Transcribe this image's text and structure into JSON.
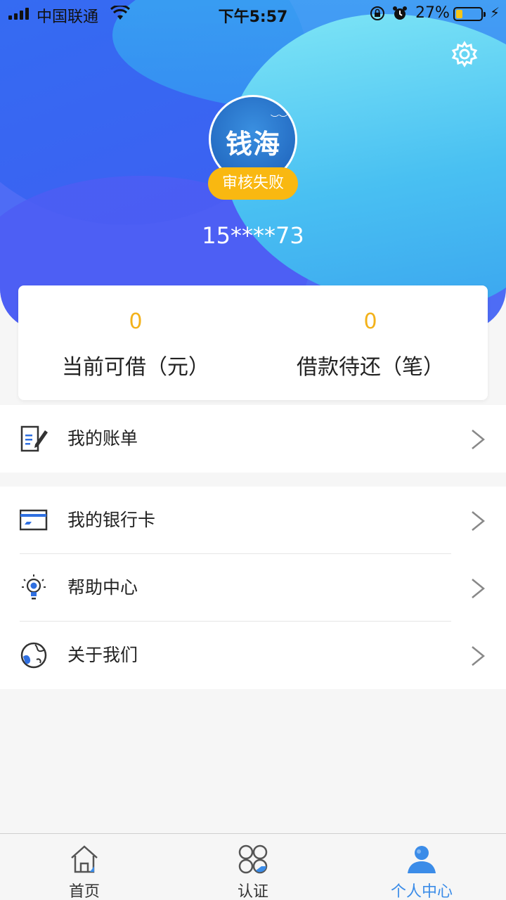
{
  "status_bar": {
    "carrier": "中国联通",
    "time": "下午5:57",
    "battery_percent": "27%",
    "battery_level": 0.27,
    "icons": [
      "signal-icon",
      "wifi-icon",
      "orientation-lock-icon",
      "alarm-icon",
      "battery-icon",
      "charging-icon"
    ]
  },
  "profile": {
    "avatar_text": "钱海",
    "status_badge": "审核失败",
    "phone": "15****73"
  },
  "stats": [
    {
      "value": "0",
      "label": "当前可借（元）"
    },
    {
      "value": "0",
      "label": "借款待还（笔）"
    }
  ],
  "menu_group1": [
    {
      "label": "我的账单",
      "icon": "bill-icon"
    }
  ],
  "menu_group2": [
    {
      "label": "我的银行卡",
      "icon": "bank-card-icon"
    },
    {
      "label": "帮助中心",
      "icon": "lightbulb-icon"
    },
    {
      "label": "关于我们",
      "icon": "globe-icon"
    }
  ],
  "tabbar": {
    "items": [
      {
        "label": "首页",
        "icon": "home-icon",
        "active": false
      },
      {
        "label": "认证",
        "icon": "certification-icon",
        "active": false
      },
      {
        "label": "个人中心",
        "icon": "user-icon",
        "active": true
      }
    ]
  },
  "colors": {
    "accent_blue": "#3b8ce8",
    "badge_yellow": "#f9b811",
    "stat_value": "#f3b21a"
  }
}
